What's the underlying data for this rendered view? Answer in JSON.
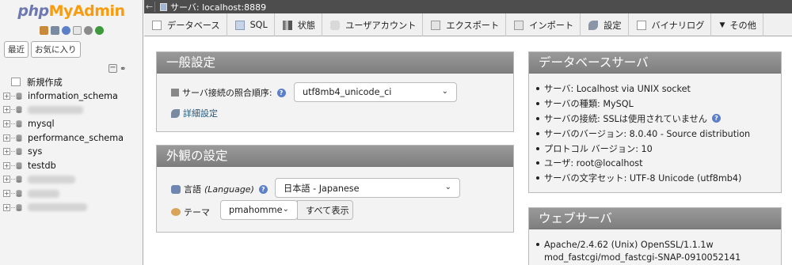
{
  "logo": {
    "part1": "php",
    "part2": "My",
    "part3": "Admin"
  },
  "nav": {
    "tabs": [
      "最近",
      "お気に入り"
    ],
    "new_label": "新規作成",
    "databases": [
      "information_schema",
      "mysql",
      "performance_schema",
      "sys",
      "testdb"
    ],
    "hidden_count": 3
  },
  "topbar": {
    "back": "←",
    "server_label": "サーバ: localhost:8889"
  },
  "menu": [
    {
      "label": "データベース",
      "icon": "database-icon"
    },
    {
      "label": "SQL",
      "icon": "sql-icon"
    },
    {
      "label": "状態",
      "icon": "status-icon"
    },
    {
      "label": "ユーザアカウント",
      "icon": "users-icon"
    },
    {
      "label": "エクスポート",
      "icon": "export-icon"
    },
    {
      "label": "インポート",
      "icon": "import-icon"
    },
    {
      "label": "設定",
      "icon": "settings-icon"
    },
    {
      "label": "バイナリログ",
      "icon": "binlog-icon"
    },
    {
      "label": "その他",
      "icon": "more-icon"
    }
  ],
  "general": {
    "title": "一般設定",
    "collation_label": "サーバ接続の照合順序:",
    "collation_value": "utf8mb4_unicode_ci",
    "detail_link": "詳細設定"
  },
  "appearance": {
    "title": "外観の設定",
    "language_label": "言語",
    "language_label_en": "(Language)",
    "language_value": "日本語 - Japanese",
    "theme_label": "テーマ",
    "theme_value": "pmahomme",
    "show_all": "すべて表示"
  },
  "dbserver": {
    "title": "データベースサーバ",
    "items": [
      "サーバ: Localhost via UNIX socket",
      "サーバの種類: MySQL",
      "サーバの接続: SSLは使用されていません",
      "サーバのバージョン: 8.0.40 - Source distribution",
      "プロトコル バージョン: 10",
      "ユーザ: root@localhost",
      "サーバの文字セット: UTF-8 Unicode (utf8mb4)"
    ]
  },
  "webserver": {
    "title": "ウェブサーバ",
    "items": [
      "Apache/2.4.62 (Unix) OpenSSL/1.1.1w",
      "mod_fastcgi/mod_fastcgi-SNAP-0910052141"
    ]
  }
}
